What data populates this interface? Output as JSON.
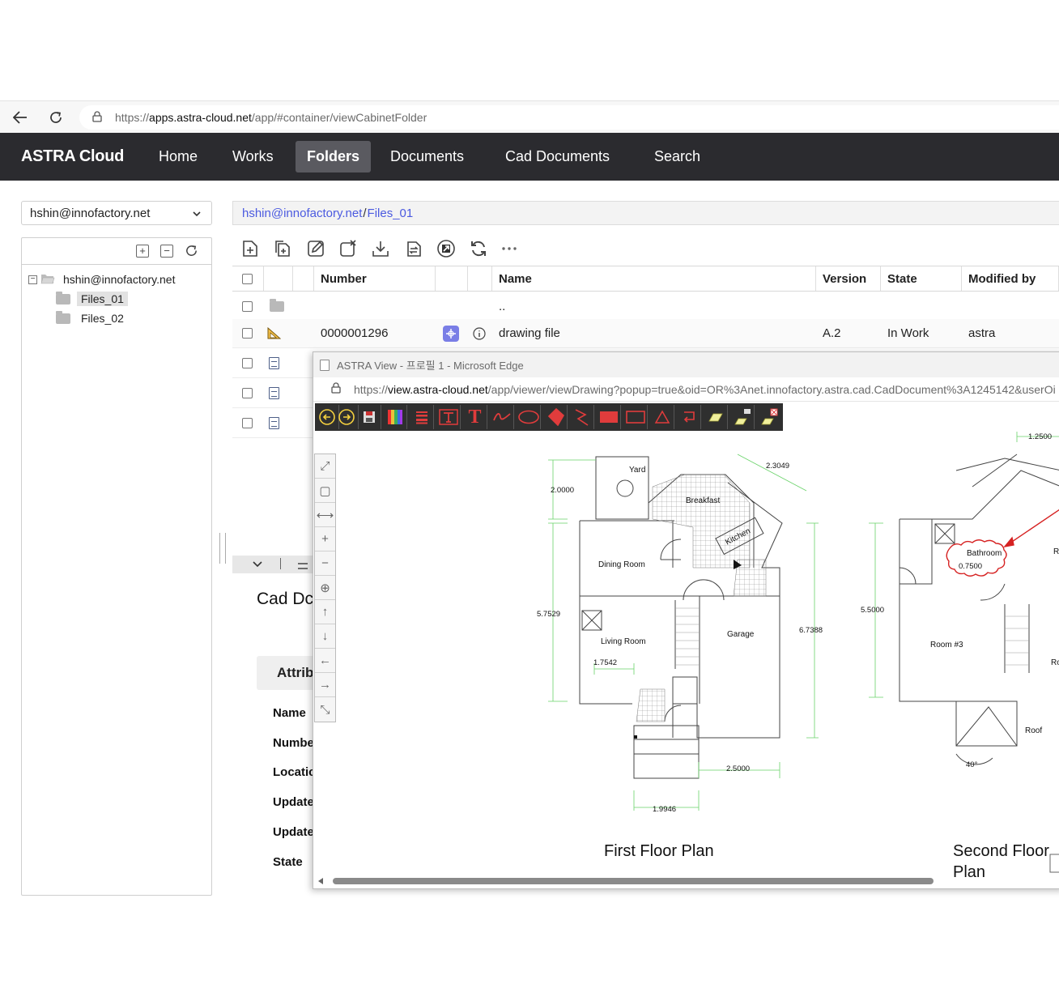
{
  "browser": {
    "url_scheme": "https://",
    "url_host": "apps.astra-cloud.net",
    "url_path": "/app/#container/viewCabinetFolder"
  },
  "app": {
    "brand": "ASTRA Cloud",
    "nav": [
      {
        "label": "Home"
      },
      {
        "label": "Works"
      },
      {
        "label": "Folders",
        "active": true
      },
      {
        "label": "Documents"
      },
      {
        "label": "Cad Documents"
      },
      {
        "label": "Search"
      }
    ]
  },
  "left_panel": {
    "account": "hshin@innofactory.net",
    "tree_root": "hshin@innofactory.net",
    "tree_children": [
      {
        "label": "Files_01",
        "selected": true
      },
      {
        "label": "Files_02"
      }
    ]
  },
  "breadcrumb": {
    "root": "hshin@innofactory.net",
    "sep": "/",
    "current": "Files_01"
  },
  "table": {
    "headers": {
      "number": "Number",
      "name": "Name",
      "version": "Version",
      "state": "State",
      "modified_by": "Modified by"
    },
    "parent_row_name": "..",
    "doc_row": {
      "number": "0000001296",
      "name": "drawing file",
      "version": "A.2",
      "state": "In Work",
      "modified_by": "astra"
    }
  },
  "detail": {
    "title": "Cad Dc",
    "tab": "Attrib",
    "labels": [
      "Name",
      "Numbe",
      "Locatic",
      "Update",
      "Update",
      "State"
    ]
  },
  "viewer": {
    "window_title": "ASTRA View - 프로필 1 - Microsoft Edge",
    "url_scheme": "https://",
    "url_host": "view.astra-cloud.net",
    "url_path": "/app/viewer/viewDrawing?popup=true&oid=OR%3Anet.innofactory.astra.cad.CadDocument%3A1245142&userOi",
    "drawing": {
      "first_floor_title": "First Floor Plan",
      "second_floor_title_line1": "Second Floor",
      "second_floor_title_line2": "Plan",
      "rooms": {
        "yard": "Yard",
        "breakfast": "Breakfast",
        "kitchen": "Kitchen",
        "dining": "Dining Room",
        "living": "Living Room",
        "garage": "Garage",
        "bathroom": "Bathroom",
        "room3": "Room #3",
        "roof": "Roof",
        "r_partial": "R",
        "ro_partial": "Ro"
      },
      "dims": {
        "d1": "2.0000",
        "d2": "2.3049",
        "d3": "5.7529",
        "d4": "1.7542",
        "d5": "6.7388",
        "d6": "2.5000",
        "d7": "1.9946",
        "d8": "5.5000",
        "d9": "1.2500",
        "d10": "0.7500",
        "angle": "40°"
      }
    }
  },
  "colors": {
    "nav_bg": "#2b2b2f",
    "link_blue": "#4b5ae0",
    "cad_toolbar_bg": "#2f2f2f",
    "cad_red": "#e03c3c"
  }
}
